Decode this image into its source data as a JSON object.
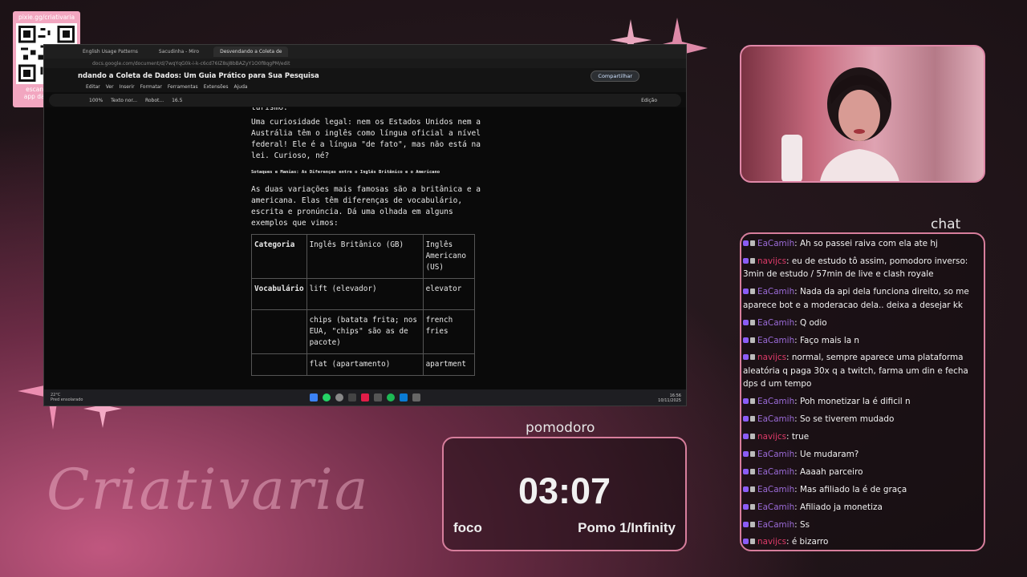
{
  "overlay": {
    "qr_url": "pixie.gg/criativaria",
    "qr_caption_1": "escaneie pelo",
    "qr_caption_2": "app da câmera",
    "brand": "Criativaria"
  },
  "browser": {
    "tabs": [
      "English Usage Patterns",
      "Sacudinha - Miro",
      "Desvendando a Coleta de"
    ],
    "address": "docs.google.com/document/d/7wqYqG0k-i-k-c6cd76IZ8sJ8bBAZyY1O0f8qgPM/edit",
    "doc_title": "ndando a Coleta de Dados: Um Guia Prático para Sua Pesquisa",
    "share_label": "Compartilhar",
    "menu": [
      "Editar",
      "Ver",
      "Inserir",
      "Formatar",
      "Ferramentas",
      "Extensões",
      "Ajuda"
    ],
    "toolbar": {
      "zoom": "100%",
      "style": "Texto nor...",
      "font": "Robot...",
      "size": "16.5",
      "mode": "Edição"
    }
  },
  "doc": {
    "cut_line": "turismo.",
    "p1": "Uma curiosidade legal: nem os Estados Unidos nem a Austrália têm o inglês como língua oficial a nível federal! Ele é a língua \"de fato\", mas não está na lei. Curioso, né?",
    "heading": "Sotaques e Manias: As Diferenças entre o Inglês Britânico e o Americano",
    "p2": "As duas variações mais famosas são a britânica e a americana. Elas têm diferenças de vocabulário, escrita e pronúncia. Dá uma olhada em alguns exemplos que vimos:",
    "table": {
      "headers": [
        "Categoria",
        "Inglês Britânico (GB)",
        "Inglês Americano (US)"
      ],
      "rows": [
        [
          "Vocabulário",
          "lift (elevador)",
          "elevator"
        ],
        [
          "",
          "chips (batata frita; nos EUA, \"chips\" são as de pacote)",
          "french fries"
        ],
        [
          "",
          "flat (apartamento)",
          "apartment"
        ]
      ]
    }
  },
  "taskbar": {
    "weather": "22°C",
    "weather_desc": "Pred ensolarado",
    "time": "16:56",
    "date": "10/11/2025"
  },
  "chat": {
    "label": "chat",
    "messages": [
      {
        "user": "EaCamih",
        "type": "u1",
        "text": "Ah so passei raiva com ela ate hj"
      },
      {
        "user": "navijcs",
        "type": "u2",
        "text": "eu de estudo tô assim, pomodoro inverso: 3min de estudo / 57min de live e clash royale"
      },
      {
        "user": "EaCamih",
        "type": "u1",
        "text": "Nada da api dela funciona direito, so me aparece bot e a moderacao dela.. deixa a desejar kk"
      },
      {
        "user": "EaCamih",
        "type": "u1",
        "text": "Q odio"
      },
      {
        "user": "EaCamih",
        "type": "u1",
        "text": "Faço mais la n"
      },
      {
        "user": "navijcs",
        "type": "u2",
        "text": "normal, sempre aparece uma plataforma aleatória q paga 30x q a twitch, farma um din e fecha dps d um tempo"
      },
      {
        "user": "EaCamih",
        "type": "u1",
        "text": "Poh monetizar la é dificil n"
      },
      {
        "user": "EaCamih",
        "type": "u1",
        "text": "So se tiverem mudado"
      },
      {
        "user": "navijcs",
        "type": "u2",
        "text": "true"
      },
      {
        "user": "EaCamih",
        "type": "u1",
        "text": "Ue mudaram?"
      },
      {
        "user": "EaCamih",
        "type": "u1",
        "text": "Aaaah parceiro"
      },
      {
        "user": "EaCamih",
        "type": "u1",
        "text": "Mas afiliado la é de graça"
      },
      {
        "user": "EaCamih",
        "type": "u1",
        "text": "Afiliado ja monetiza"
      },
      {
        "user": "EaCamih",
        "type": "u1",
        "text": "Ss"
      },
      {
        "user": "navijcs",
        "type": "u2",
        "text": "é bizarro"
      }
    ]
  },
  "pomodoro": {
    "label": "pomodoro",
    "time": "03:07",
    "mode": "foco",
    "count": "Pomo 1/Infinity"
  },
  "colors": {
    "accent": "#d77e9c",
    "user1": "#9b6bd8",
    "user2": "#e03b6a"
  }
}
